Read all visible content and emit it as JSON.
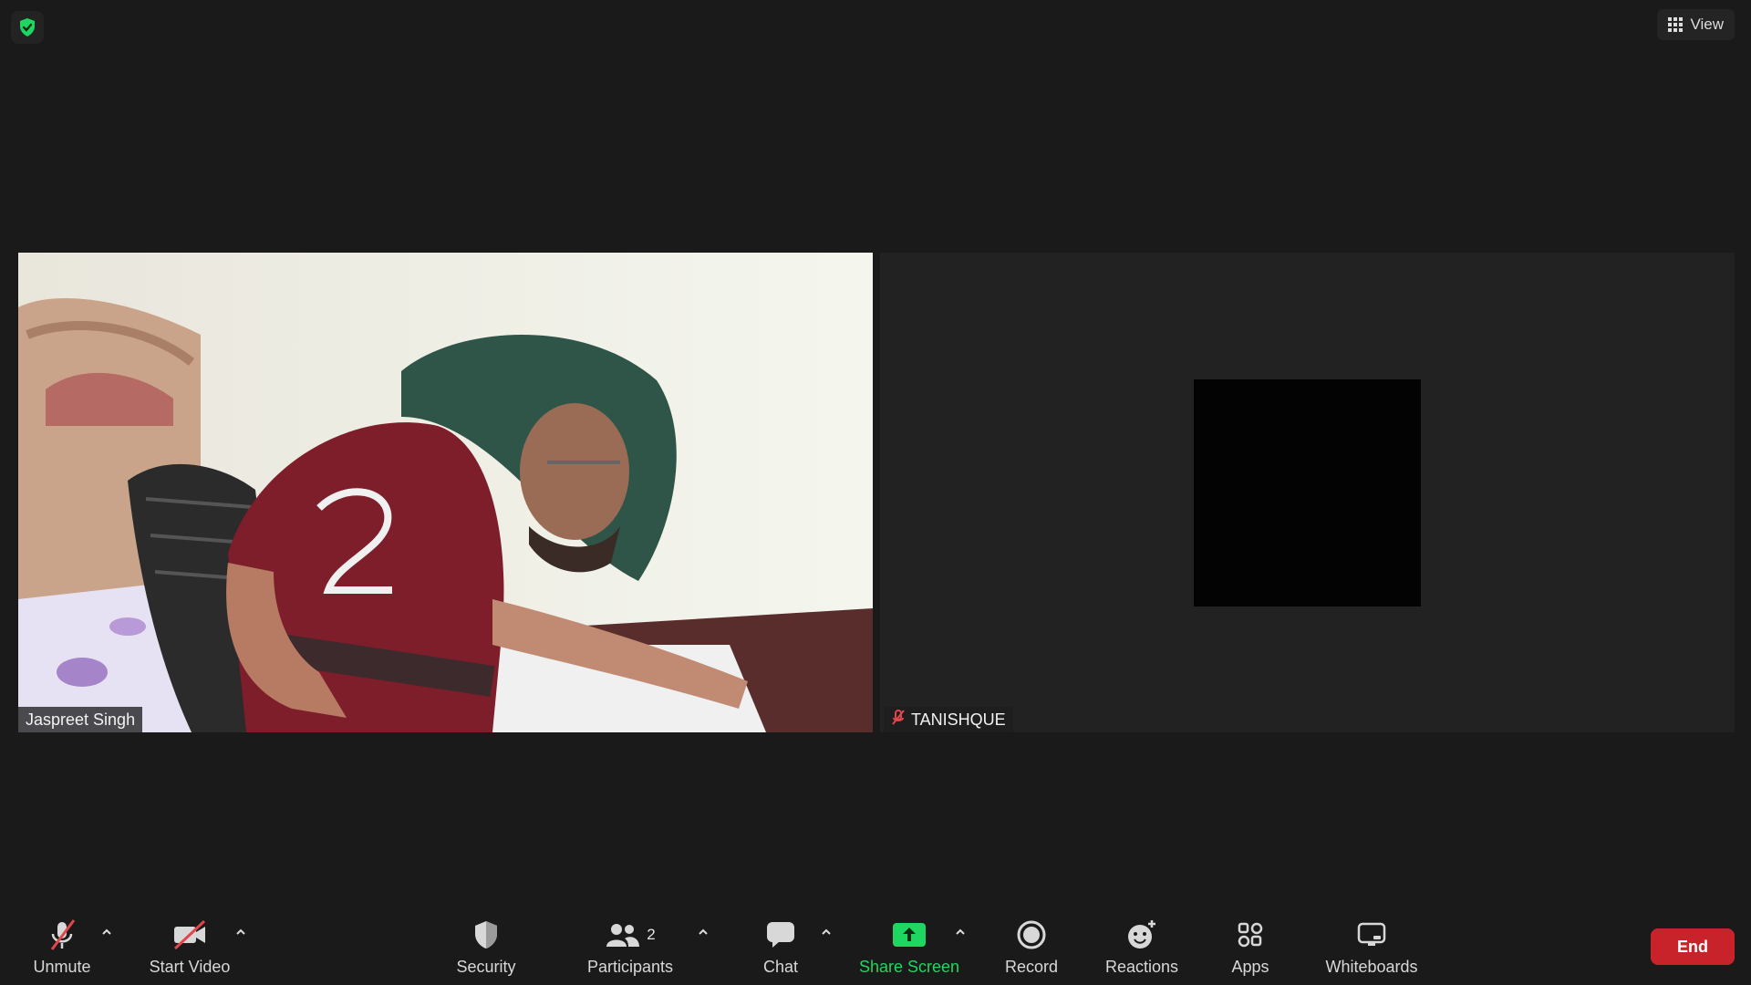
{
  "top": {
    "view_label": "View"
  },
  "participants_tiles": [
    {
      "name": "Jaspreet Singh"
    },
    {
      "name": "TANISHQUE"
    }
  ],
  "toolbar": {
    "unmute": "Unmute",
    "start_video": "Start Video",
    "security": "Security",
    "participants": "Participants",
    "participants_count": "2",
    "chat": "Chat",
    "share_screen": "Share Screen",
    "record": "Record",
    "reactions": "Reactions",
    "apps": "Apps",
    "whiteboards": "Whiteboards",
    "end": "End"
  },
  "colors": {
    "accent_green": "#1ed760",
    "end_red": "#c8232b",
    "mute_red": "#e0464b"
  },
  "icons": [
    "shield-check-icon",
    "grid-icon",
    "mic-off-icon",
    "video-off-icon",
    "security-shield-icon",
    "participants-icon",
    "chat-icon",
    "share-screen-icon",
    "record-icon",
    "reactions-icon",
    "apps-icon",
    "whiteboards-icon",
    "chevron-up-icon"
  ]
}
